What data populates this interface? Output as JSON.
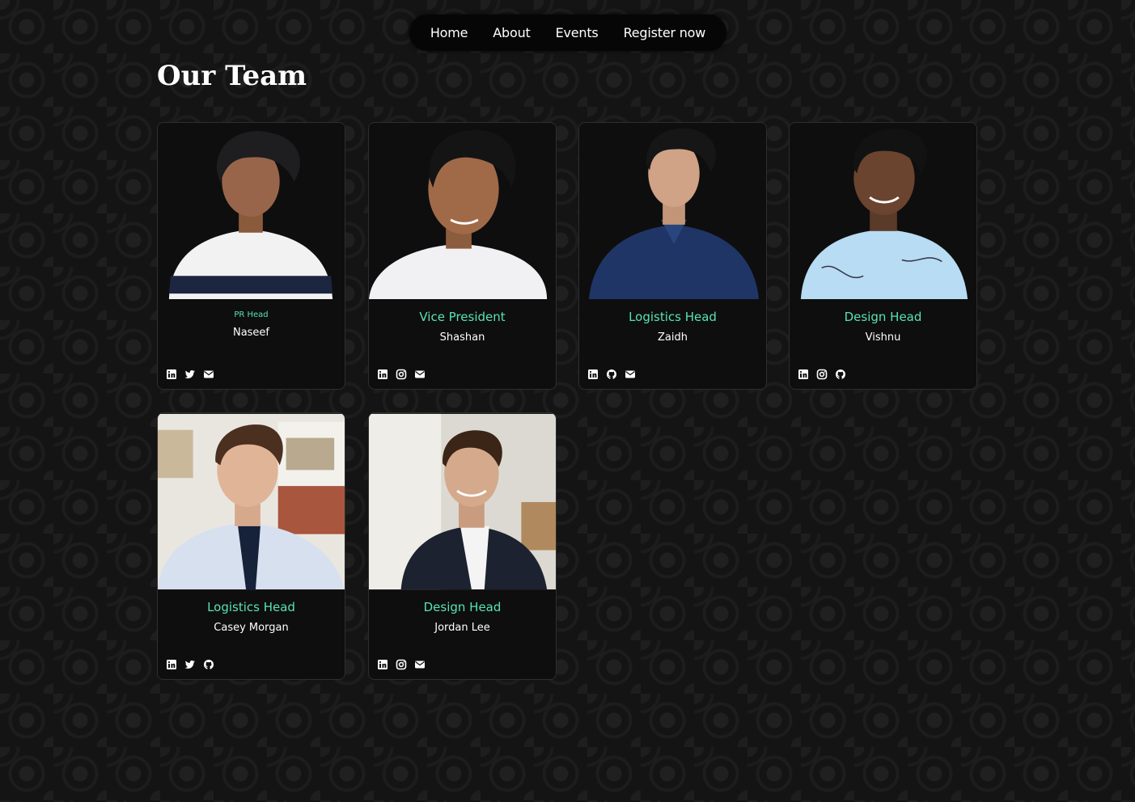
{
  "nav": {
    "items": [
      {
        "label": "Home"
      },
      {
        "label": "About"
      },
      {
        "label": "Events"
      },
      {
        "label": "Register now"
      }
    ]
  },
  "page": {
    "title": "Our Team"
  },
  "colors": {
    "accent": "#57e3b5",
    "card_bg": "#0e0e0e",
    "nav_bg": "#060606"
  },
  "team": [
    {
      "role": "PR Head",
      "name": "Naseef",
      "photo": "portrait-photo",
      "socials": [
        "linkedin-icon",
        "twitter-icon",
        "email-icon"
      ]
    },
    {
      "role": "Vice President",
      "name": "Shashan",
      "photo": "portrait-photo",
      "socials": [
        "linkedin-icon",
        "instagram-icon",
        "email-icon"
      ]
    },
    {
      "role": "Logistics Head",
      "name": "Zaidh",
      "photo": "portrait-photo",
      "socials": [
        "linkedin-icon",
        "github-icon",
        "email-icon"
      ]
    },
    {
      "role": "Design Head",
      "name": "Vishnu",
      "photo": "portrait-photo",
      "socials": [
        "linkedin-icon",
        "instagram-icon",
        "github-icon"
      ]
    },
    {
      "role": "Logistics Head",
      "name": "Casey Morgan",
      "photo": "portrait-photo",
      "socials": [
        "linkedin-icon",
        "twitter-icon",
        "github-icon"
      ]
    },
    {
      "role": "Design Head",
      "name": "Jordan Lee",
      "photo": "portrait-photo",
      "socials": [
        "linkedin-icon",
        "instagram-icon",
        "email-icon"
      ]
    }
  ]
}
